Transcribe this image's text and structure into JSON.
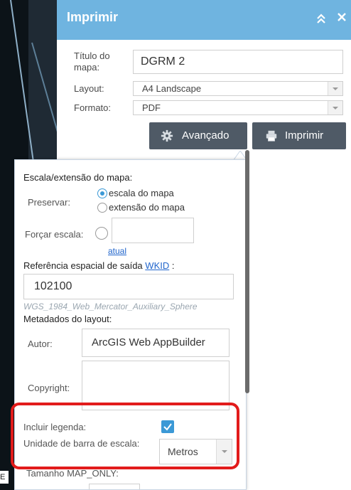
{
  "panel": {
    "title": "Imprimir"
  },
  "form": {
    "map_title_label": "Título do mapa:",
    "map_title_value": "DGRM 2",
    "layout_label": "Layout:",
    "layout_value": "A4 Landscape",
    "format_label": "Formato:",
    "format_value": "PDF"
  },
  "buttons": {
    "advanced": "Avançado",
    "print": "Imprimir"
  },
  "advanced": {
    "scale_section": "Escala/extensão do mapa:",
    "preserve_label": "Preservar:",
    "preserve_options": [
      "escala do mapa",
      "extensão do mapa"
    ],
    "preserve_selected": "escala do mapa",
    "force_scale_label": "Forçar escala:",
    "force_scale_value": "",
    "current_link": "atual",
    "sr_label": "Referência espacial de saída",
    "sr_link": "WKID",
    "sr_colon": ":",
    "wkid_value": "102100",
    "wkid_name": "WGS_1984_Web_Mercator_Auxiliary_Sphere",
    "metadata_section": "Metadados do layout:",
    "author_label": "Autor:",
    "author_value": "ArcGIS Web AppBuilder",
    "copyright_label": "Copyright:",
    "copyright_value": "",
    "include_legend_label": "Incluir legenda:",
    "include_legend_checked": true,
    "scalebar_unit_label": "Unidade de barra de escala:",
    "scalebar_unit_value": "Metros",
    "map_only_size_label": "Tamanho MAP_ONLY:"
  },
  "map": {
    "edge_text": "E"
  },
  "colors": {
    "header": "#6fb4e0",
    "button": "#4f5a66",
    "highlight": "#e21b1b",
    "checkbox": "#3b99d6"
  }
}
